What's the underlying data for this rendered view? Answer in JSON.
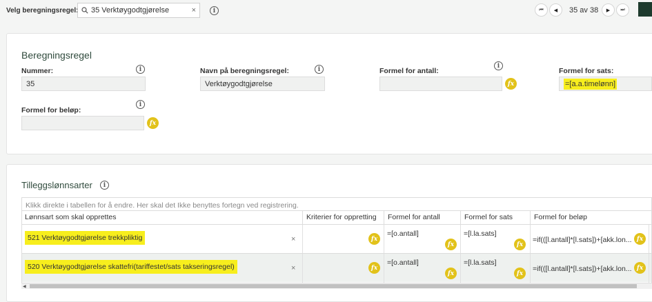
{
  "top": {
    "label": "Velg beregningsregel:",
    "search_value": "35 Verktøygodtgjørelse",
    "pager": "35 av 38"
  },
  "rule": {
    "title": "Beregningsregel",
    "nummer_label": "Nummer:",
    "nummer_value": "35",
    "navn_label": "Navn på beregningsregel:",
    "navn_value": "Verktøygodtgjørelse",
    "antall_label": "Formel for antall:",
    "antall_value": "",
    "sats_label": "Formel for sats:",
    "sats_value": "=[a.a.timelønn]",
    "belop_label": "Formel for beløp:",
    "belop_value": ""
  },
  "tillegg": {
    "title": "Tilleggslønnsarter",
    "hint": "Klikk direkte i tabellen for å endre. Her skal det Ikke benyttes fortegn ved registrering.",
    "columns": [
      "Lønnsart som skal opprettes",
      "Kriterier for oppretting",
      "Formel for antall",
      "Formel for sats",
      "Formel for beløp"
    ],
    "rows": [
      {
        "lonnsart": "521 Verktøygodtgjørelse trekkpliktig",
        "kriterier": "",
        "antall": "=[o.antall]",
        "sats": "=[l.la.sats]",
        "belop": "=if(([l.antall]*[l.sats])+[akk.lon..."
      },
      {
        "lonnsart": "520 Verktøygodtgjørelse skattefri(tariffestet/sats takseringsregel)",
        "kriterier": "",
        "antall": "=[o.antall]",
        "sats": "=[l.la.sats]",
        "belop": "=if(([l.antall]*[l.sats])+[akk.lon..."
      }
    ]
  },
  "icons": {
    "info": "info-icon",
    "fx": "fx-formula-icon",
    "search": "search-icon",
    "clear": "clear-icon"
  },
  "colors": {
    "highlight": "#f7ee1d",
    "fx": "#e2c21a",
    "dark_button": "#1e3b2e"
  }
}
